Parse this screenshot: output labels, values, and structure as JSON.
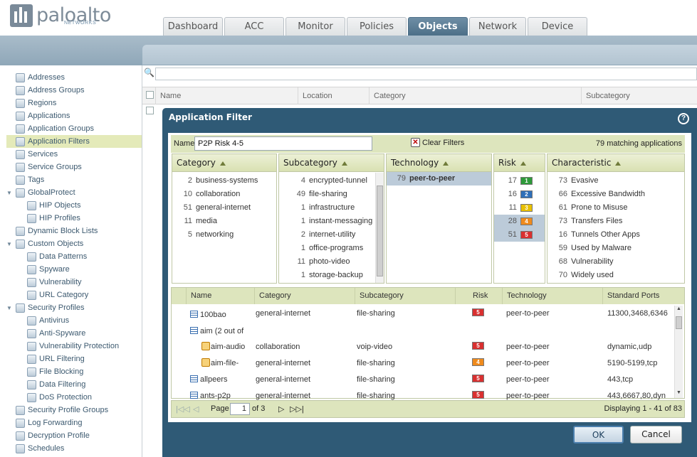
{
  "brand": {
    "name": "paloalto",
    "sub": "NETWORKS"
  },
  "tabs": [
    "Dashboard",
    "ACC",
    "Monitor",
    "Policies",
    "Objects",
    "Network",
    "Device"
  ],
  "active_tab": "Objects",
  "sidebar": [
    {
      "label": "Addresses",
      "level": 0
    },
    {
      "label": "Address Groups",
      "level": 0
    },
    {
      "label": "Regions",
      "level": 0
    },
    {
      "label": "Applications",
      "level": 0
    },
    {
      "label": "Application Groups",
      "level": 0
    },
    {
      "label": "Application Filters",
      "level": 0,
      "selected": true
    },
    {
      "label": "Services",
      "level": 0
    },
    {
      "label": "Service Groups",
      "level": 0
    },
    {
      "label": "Tags",
      "level": 0
    },
    {
      "label": "GlobalProtect",
      "level": 0,
      "expand": true
    },
    {
      "label": "HIP Objects",
      "level": 1
    },
    {
      "label": "HIP Profiles",
      "level": 1
    },
    {
      "label": "Dynamic Block Lists",
      "level": 0
    },
    {
      "label": "Custom Objects",
      "level": 0,
      "expand": true
    },
    {
      "label": "Data Patterns",
      "level": 1
    },
    {
      "label": "Spyware",
      "level": 1
    },
    {
      "label": "Vulnerability",
      "level": 1
    },
    {
      "label": "URL Category",
      "level": 1
    },
    {
      "label": "Security Profiles",
      "level": 0,
      "expand": true
    },
    {
      "label": "Antivirus",
      "level": 1
    },
    {
      "label": "Anti-Spyware",
      "level": 1
    },
    {
      "label": "Vulnerability Protection",
      "level": 1
    },
    {
      "label": "URL Filtering",
      "level": 1
    },
    {
      "label": "File Blocking",
      "level": 1
    },
    {
      "label": "Data Filtering",
      "level": 1
    },
    {
      "label": "DoS Protection",
      "level": 1
    },
    {
      "label": "Security Profile Groups",
      "level": 0
    },
    {
      "label": "Log Forwarding",
      "level": 0
    },
    {
      "label": "Decryption Profile",
      "level": 0
    },
    {
      "label": "Schedules",
      "level": 0
    }
  ],
  "bg_columns": [
    "Name",
    "Location",
    "Category",
    "Subcategory"
  ],
  "dialog": {
    "title": "Application Filter",
    "help": "?",
    "name_label": "Name",
    "name_value": "P2P Risk 4-5",
    "clear_filters": "Clear Filters",
    "matching": "79 matching applications",
    "filters": {
      "category": {
        "title": "Category",
        "items": [
          {
            "n": "2",
            "t": "business-systems"
          },
          {
            "n": "10",
            "t": "collaboration"
          },
          {
            "n": "51",
            "t": "general-internet"
          },
          {
            "n": "11",
            "t": "media"
          },
          {
            "n": "5",
            "t": "networking"
          }
        ]
      },
      "subcategory": {
        "title": "Subcategory",
        "items": [
          {
            "n": "4",
            "t": "encrypted-tunnel"
          },
          {
            "n": "49",
            "t": "file-sharing"
          },
          {
            "n": "1",
            "t": "infrastructure"
          },
          {
            "n": "1",
            "t": "instant-messaging"
          },
          {
            "n": "2",
            "t": "internet-utility"
          },
          {
            "n": "1",
            "t": "office-programs"
          },
          {
            "n": "11",
            "t": "photo-video"
          },
          {
            "n": "1",
            "t": "storage-backup"
          }
        ]
      },
      "technology": {
        "title": "Technology",
        "items": [
          {
            "n": "79",
            "t": "peer-to-peer",
            "selected": true
          }
        ]
      },
      "risk": {
        "title": "Risk",
        "items": [
          {
            "n": "17",
            "level": "1",
            "color": "#2e9a3a"
          },
          {
            "n": "16",
            "level": "2",
            "color": "#2f6fb8"
          },
          {
            "n": "11",
            "level": "3",
            "color": "#e8c000"
          },
          {
            "n": "28",
            "level": "4",
            "color": "#ef8a1c",
            "selected": true
          },
          {
            "n": "51",
            "level": "5",
            "color": "#d93030",
            "selected": true
          }
        ]
      },
      "characteristic": {
        "title": "Characteristic",
        "items": [
          {
            "n": "73",
            "t": "Evasive"
          },
          {
            "n": "66",
            "t": "Excessive Bandwidth"
          },
          {
            "n": "61",
            "t": "Prone to Misuse"
          },
          {
            "n": "73",
            "t": "Transfers Files"
          },
          {
            "n": "16",
            "t": "Tunnels Other Apps"
          },
          {
            "n": "59",
            "t": "Used by Malware"
          },
          {
            "n": "68",
            "t": "Vulnerability"
          },
          {
            "n": "70",
            "t": "Widely used"
          }
        ]
      }
    },
    "table": {
      "columns": [
        "Name",
        "Category",
        "Subcategory",
        "Risk",
        "Technology",
        "Standard Ports"
      ],
      "rows": [
        {
          "name": "100bao",
          "icon": "app",
          "category": "general-internet",
          "subcategory": "file-sharing",
          "risk": "5",
          "risk_color": "#d93030",
          "technology": "peer-to-peer",
          "ports": "11300,3468,6346"
        },
        {
          "name": "aim (2 out of",
          "icon": "app",
          "category": "",
          "subcategory": "",
          "risk": "",
          "technology": "",
          "ports": ""
        },
        {
          "name": "aim-audio",
          "icon": "sub",
          "category": "collaboration",
          "subcategory": "voip-video",
          "risk": "5",
          "risk_color": "#d93030",
          "technology": "peer-to-peer",
          "ports": "dynamic,udp"
        },
        {
          "name": "aim-file-",
          "icon": "sub",
          "category": "general-internet",
          "subcategory": "file-sharing",
          "risk": "4",
          "risk_color": "#ef8a1c",
          "technology": "peer-to-peer",
          "ports": "5190-5199,tcp"
        },
        {
          "name": "allpeers",
          "icon": "app",
          "category": "general-internet",
          "subcategory": "file-sharing",
          "risk": "5",
          "risk_color": "#d93030",
          "technology": "peer-to-peer",
          "ports": "443,tcp"
        },
        {
          "name": "ants-p2p",
          "icon": "app",
          "category": "general-internet",
          "subcategory": "file-sharing",
          "risk": "5",
          "risk_color": "#d93030",
          "technology": "peer-to-peer",
          "ports": "443,6667,80,dyn"
        }
      ]
    },
    "pager": {
      "page_label": "Page",
      "page_value": "1",
      "of_label": "of 3",
      "displaying": "Displaying 1 - 41 of 83"
    },
    "ok": "OK",
    "cancel": "Cancel"
  }
}
